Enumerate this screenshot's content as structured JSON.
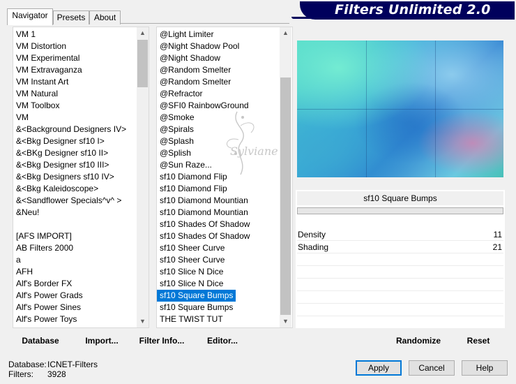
{
  "app": {
    "title": "Filters Unlimited 2.0"
  },
  "tabs": [
    {
      "label": "Navigator",
      "active": true
    },
    {
      "label": "Presets",
      "active": false
    },
    {
      "label": "About",
      "active": false
    }
  ],
  "categories": {
    "items": [
      "VM 1",
      "VM Distortion",
      "VM Experimental",
      "VM Extravaganza",
      "VM Instant Art",
      "VM Natural",
      "VM Toolbox",
      "VM",
      "&<Background Designers IV>",
      "&<Bkg Designer sf10 I>",
      "&<BKg Designer sf10 II>",
      "&<Bkg Designer sf10 III>",
      "&<Bkg Designers sf10 IV>",
      "&<Bkg Kaleidoscope>",
      "&<Sandflower Specials^v^ >",
      "&Neu!",
      "",
      "[AFS IMPORT]",
      "AB Filters 2000",
      "a",
      "AFH",
      "Alf's Border FX",
      "Alf's Power Grads",
      "Alf's Power Sines",
      "Alf's Power Toys"
    ]
  },
  "filters": {
    "items": [
      "@Light Limiter",
      "@Night Shadow Pool",
      "@Night Shadow",
      "@Random Smelter",
      "@Random Smelter",
      "@Refractor",
      "@SFI0 RainbowGround",
      "@Smoke",
      "@Spirals",
      "@Splash",
      "@Splish",
      "@Sun Raze...",
      "sf10 Diamond Flip",
      "sf10 Diamond Flip",
      "sf10 Diamond Mountian",
      "sf10 Diamond Mountian",
      "sf10 Shades Of Shadow",
      "sf10 Shades Of Shadow",
      "sf10 Sheer Curve",
      "sf10 Sheer Curve",
      "sf10 Slice N Dice",
      "sf10 Slice N Dice",
      "sf10 Square Bumps",
      "sf10 Square Bumps",
      "THE TWIST TUT"
    ],
    "selected_index": 22
  },
  "watermark": {
    "text": "Sylviane"
  },
  "preview": {
    "filter_name": "sf10 Square Bumps"
  },
  "params": [
    {
      "label": "Density",
      "value": "11"
    },
    {
      "label": "Shading",
      "value": "21"
    }
  ],
  "toolbar": {
    "database": "Database",
    "import": "Import...",
    "filter_info": "Filter Info...",
    "editor": "Editor...",
    "randomize": "Randomize",
    "reset": "Reset"
  },
  "status": {
    "database_label": "Database:",
    "database_value": "ICNET-Filters",
    "filters_label": "Filters:",
    "filters_value": "3928"
  },
  "buttons": {
    "apply": "Apply",
    "cancel": "Cancel",
    "help": "Help"
  }
}
